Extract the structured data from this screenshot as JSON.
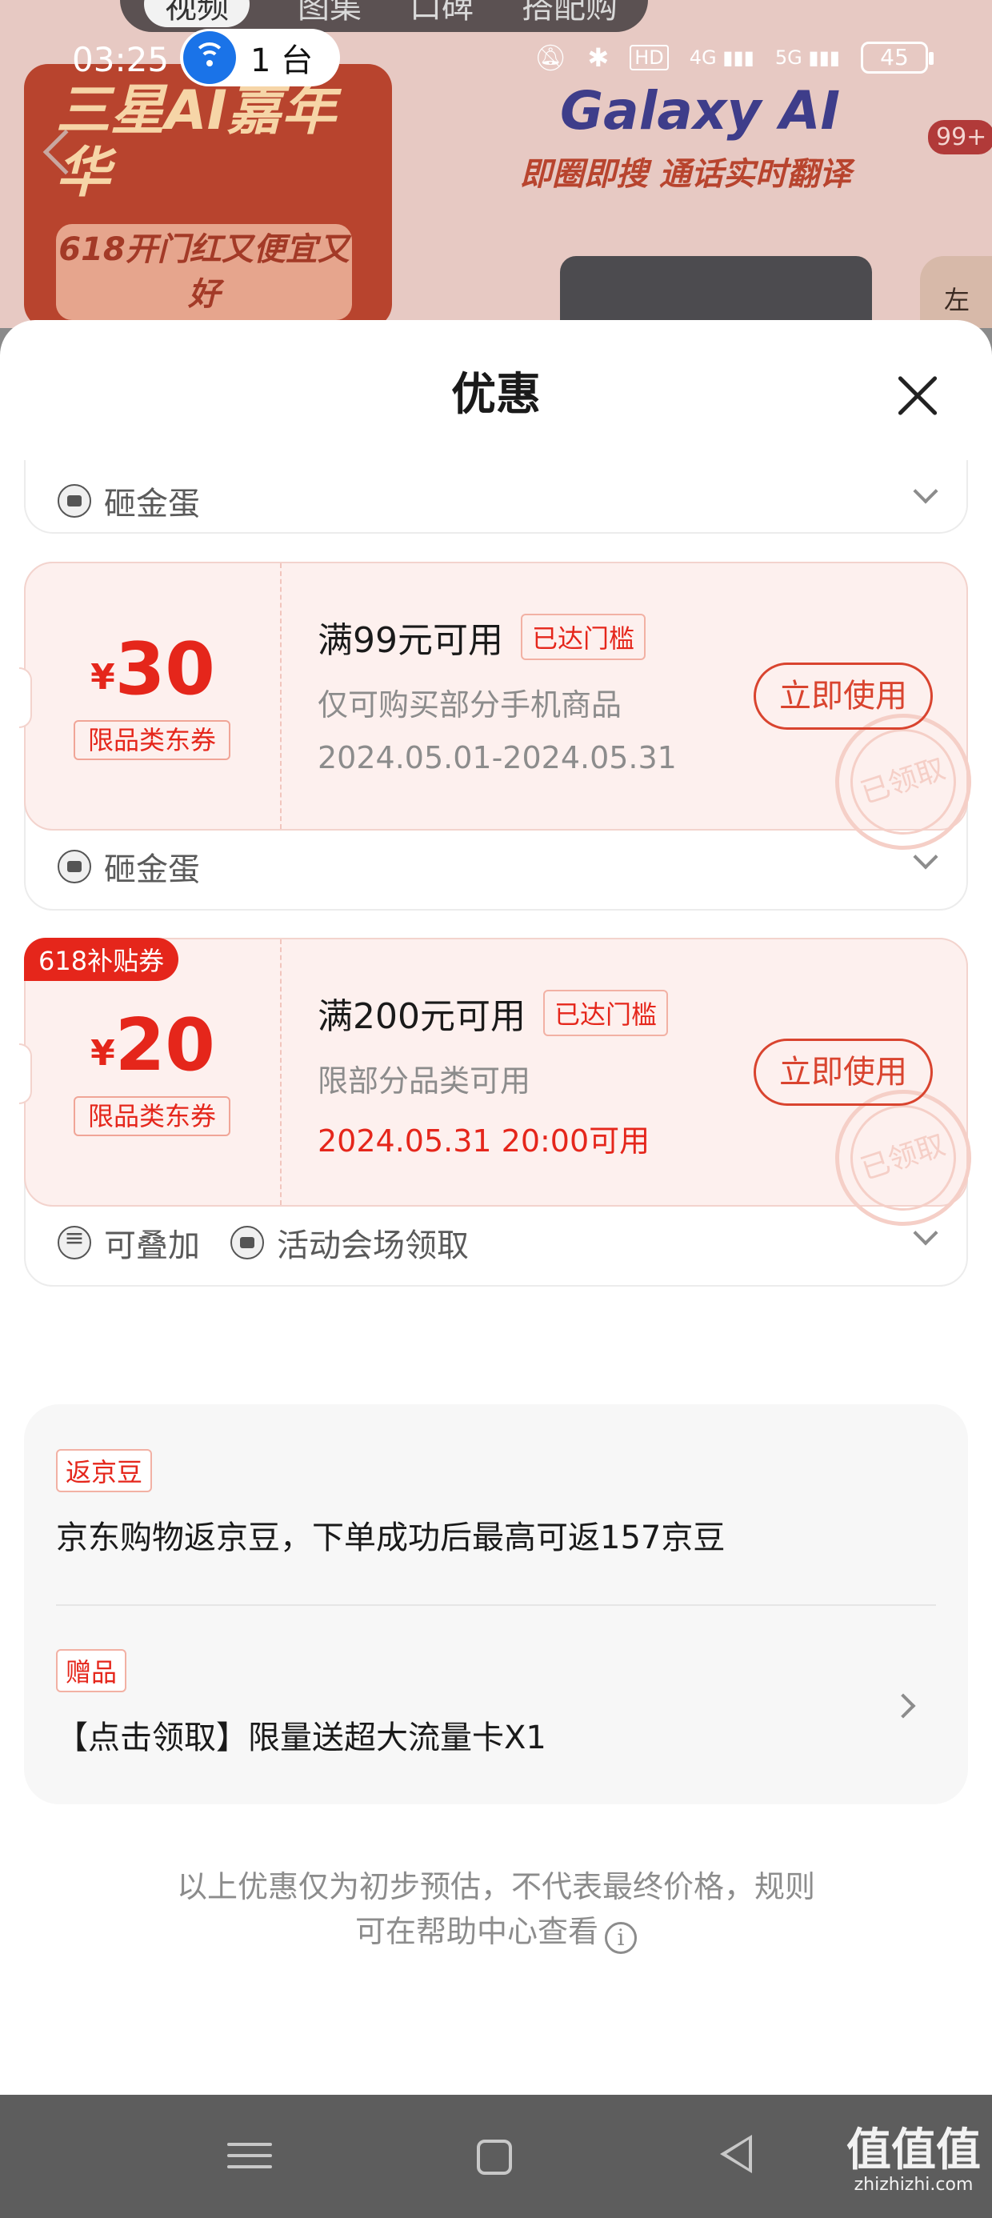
{
  "status_bar": {
    "time": "03:25",
    "hotspot_count": "1 台",
    "signal_4g": "4G",
    "signal_5g": "5G",
    "hd": "HD",
    "battery": "45"
  },
  "background_page": {
    "tabs": [
      "视频",
      "图集",
      "口碑",
      "搭配购"
    ],
    "banner_title": "三星AI嘉年华",
    "banner_sub": "618开门红又便宜又好",
    "galaxy_title": "Galaxy AI",
    "galaxy_sub": "即圈即搜 通话实时翻译",
    "badge": "99+",
    "side_label": "左"
  },
  "sheet": {
    "title": "优惠",
    "partial_card": {
      "footer_label": "砸金蛋"
    },
    "coupons": [
      {
        "currency": "¥",
        "amount": "30",
        "type": "限品类东券",
        "condition": "满99元可用",
        "met_tag": "已达门槛",
        "scope": "仅可购买部分手机商品",
        "period": "2024.05.01-2024.05.31",
        "button": "立即使用",
        "stamp": "已领取",
        "footer": [
          "砸金蛋"
        ]
      },
      {
        "badge": "618补贴券",
        "currency": "¥",
        "amount": "20",
        "type": "限品类东券",
        "condition": "满200元可用",
        "met_tag": "已达门槛",
        "scope": "限部分品类可用",
        "period": "2024.05.31 20:00可用",
        "button": "立即使用",
        "stamp": "已领取",
        "footer": [
          "可叠加",
          "活动会场领取"
        ]
      }
    ],
    "info": {
      "jingdou_tag": "返京豆",
      "jingdou_text": "京东购物返京豆，下单成功后最高可返157京豆",
      "gift_tag": "赠品",
      "gift_text": "【点击领取】限量送超大流量卡X1"
    },
    "disclaimer_line1": "以上优惠仅为初步预估，不代表最终价格，规则",
    "disclaimer_line2": "可在帮助中心查看"
  },
  "watermark": {
    "text": "值值值",
    "domain": "zhizhizhi.com"
  },
  "colors": {
    "accent_red": "#e5261b",
    "coupon_bg": "#fdf0ee",
    "nav_bg": "#5d5d5d"
  }
}
